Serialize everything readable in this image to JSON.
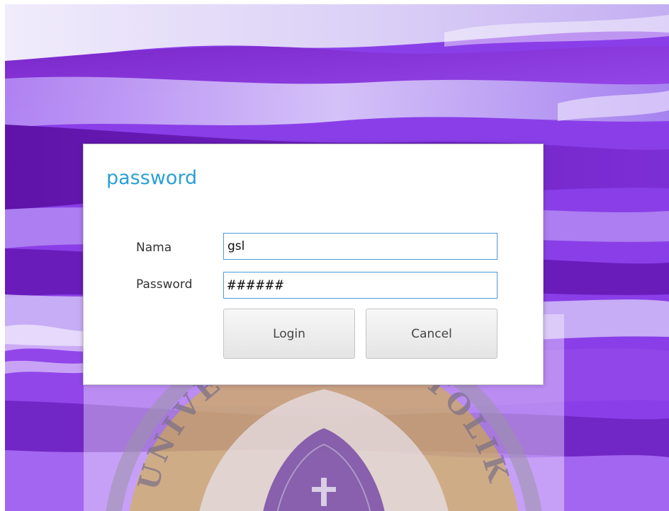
{
  "dialog": {
    "title": "password",
    "name_label": "Nama",
    "name_value": "gsl",
    "password_label": "Password",
    "password_value": "######",
    "login_label": "Login",
    "cancel_label": "Cancel"
  },
  "watermark": {
    "arc_text": "UNIVERSITAS KATOLIK"
  },
  "colors": {
    "title_accent": "#2a9fd6",
    "input_border": "#4c9ad6",
    "wallpaper_purple": "#8a3ee8",
    "wallpaper_light": "#e2d6fb",
    "watermark_gold": "#d4ae24"
  }
}
